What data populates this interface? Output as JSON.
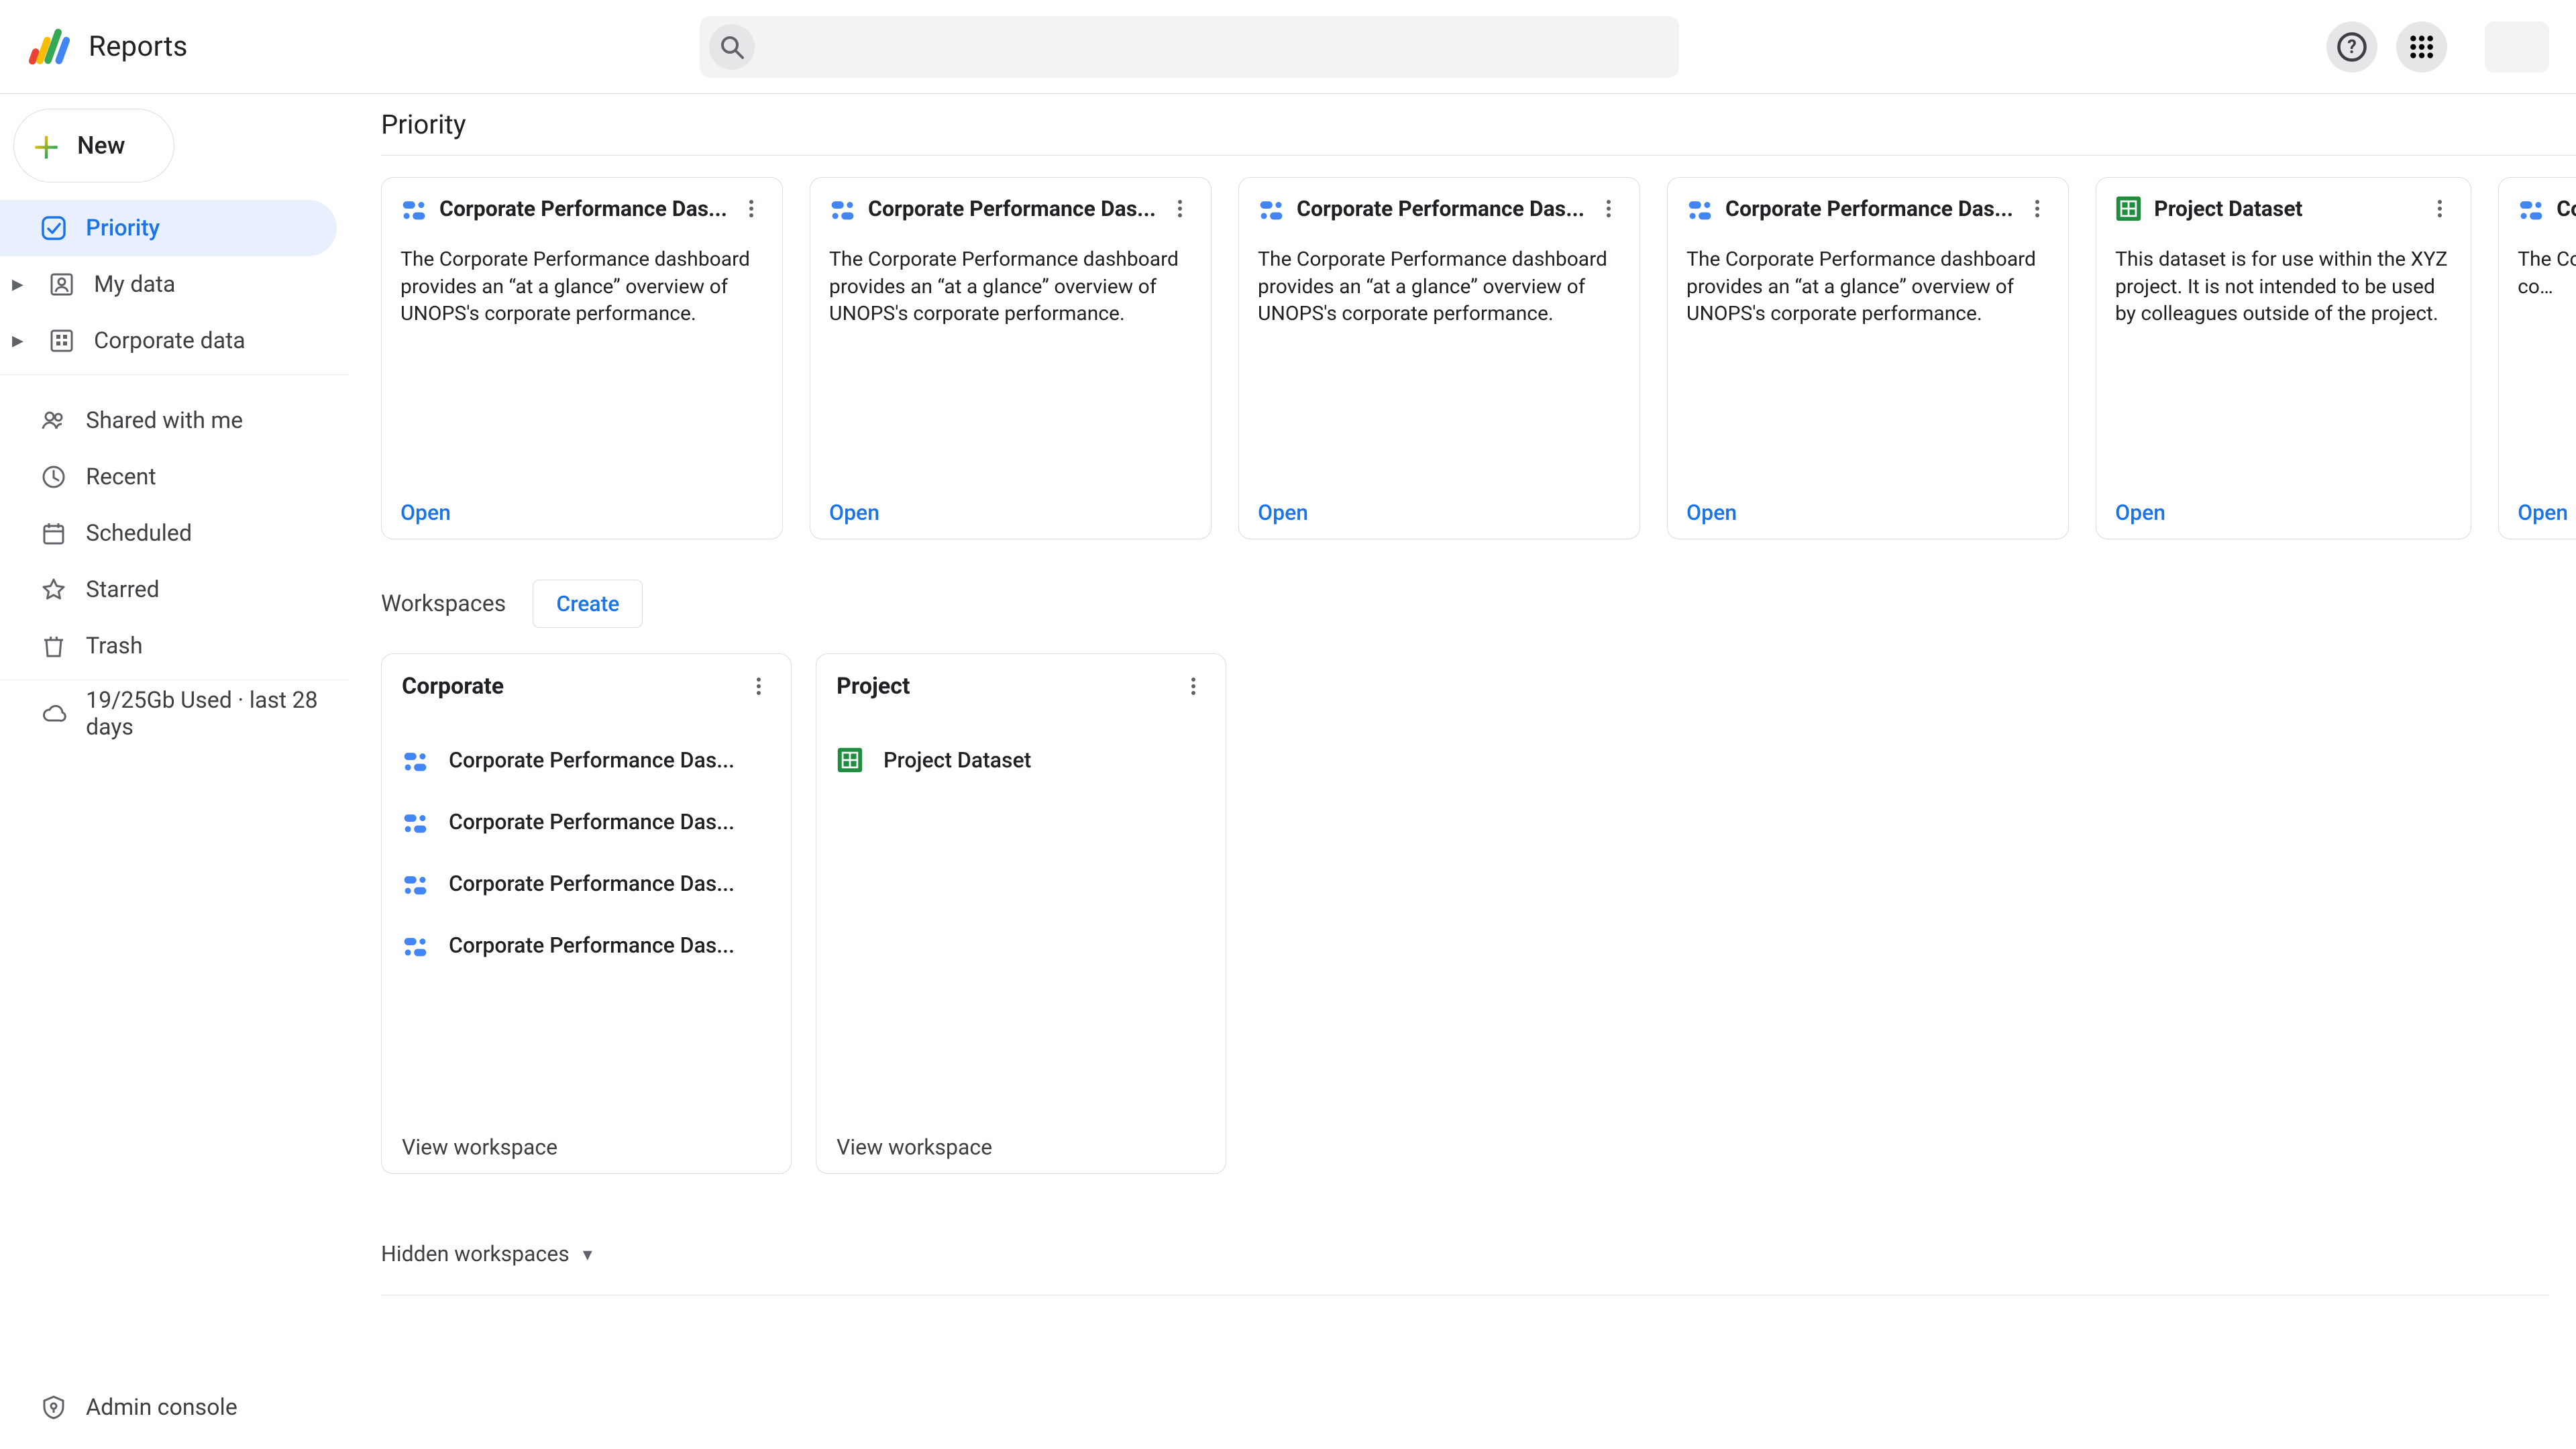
{
  "app": {
    "title": "Reports"
  },
  "search": {
    "placeholder": ""
  },
  "new_button": "New",
  "sidebar": {
    "primary": [
      {
        "icon": "priority",
        "label": "Priority",
        "active": true,
        "tree": false
      },
      {
        "icon": "person-box",
        "label": "My data",
        "active": false,
        "tree": true
      },
      {
        "icon": "building",
        "label": "Corporate data",
        "active": false,
        "tree": true
      }
    ],
    "secondary": [
      {
        "icon": "people",
        "label": "Shared with me"
      },
      {
        "icon": "clock",
        "label": "Recent"
      },
      {
        "icon": "calendar",
        "label": "Scheduled"
      },
      {
        "icon": "star",
        "label": "Starred"
      },
      {
        "icon": "trash",
        "label": "Trash"
      }
    ],
    "storage": {
      "icon": "cloud",
      "label": "19/25Gb Used · last 28 days"
    },
    "admin": {
      "icon": "admin",
      "label": "Admin console"
    }
  },
  "section_title": "Priority",
  "priority_cards": [
    {
      "type": "dashboard",
      "title": "Corporate Performance Das...",
      "desc": "The Corporate Performance dashboard provides an “at a glance” overview of UNOPS's corporate performance.",
      "open": "Open"
    },
    {
      "type": "dashboard",
      "title": "Corporate Performance Das...",
      "desc": "The Corporate Performance dashboard provides an “at a glance” overview of UNOPS's corporate performance.",
      "open": "Open"
    },
    {
      "type": "dashboard",
      "title": "Corporate Performance Das...",
      "desc": "The Corporate Performance dashboard provides an “at a glance” overview of UNOPS's corporate performance.",
      "open": "Open"
    },
    {
      "type": "dashboard",
      "title": "Corporate Performance Das...",
      "desc": "The Corporate Performance dashboard provides an “at a glance” overview of UNOPS's corporate performance.",
      "open": "Open"
    },
    {
      "type": "dataset",
      "title": "Project Dataset",
      "desc": "This dataset is for use within the XYZ project. It is not intended to be used by colleagues outside of the project.",
      "open": "Open"
    },
    {
      "type": "dashboard",
      "title": "Corpor",
      "desc": "The Corpor… provides an… UNOPS's co…",
      "open": "Open"
    }
  ],
  "workspaces_header": {
    "label": "Workspaces",
    "create": "Create"
  },
  "workspaces": [
    {
      "title": "Corporate",
      "view": "View workspace",
      "items": [
        {
          "type": "dashboard",
          "label": "Corporate Performance Das..."
        },
        {
          "type": "dashboard",
          "label": "Corporate Performance Das..."
        },
        {
          "type": "dashboard",
          "label": "Corporate Performance Das..."
        },
        {
          "type": "dashboard",
          "label": "Corporate Performance Das..."
        }
      ]
    },
    {
      "title": "Project",
      "view": "View workspace",
      "items": [
        {
          "type": "dataset",
          "label": "Project Dataset"
        }
      ]
    }
  ],
  "hidden_workspaces_label": "Hidden workspaces"
}
